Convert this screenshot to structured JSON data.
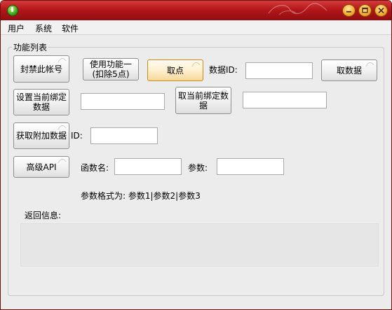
{
  "menu": {
    "items": [
      "用户",
      "系统",
      "软件"
    ]
  },
  "group": {
    "title": "功能列表"
  },
  "buttons": {
    "ban_account": "封禁此帐号",
    "use_feature_one": "使用功能一(扣除5点)",
    "get_point": "取点",
    "get_data": "取数据",
    "set_bind_data": "设置当前绑定数据",
    "cancel_bind_data": "取当前绑定数据",
    "get_extra_data": "获取附加数据",
    "advanced_api": "高级API"
  },
  "labels": {
    "data_id": "数据ID:",
    "id": "ID:",
    "function_name": "函数名:",
    "param": "参数:",
    "param_format": "参数格式为: 参数1|参数2|参数3",
    "return_info": "返回信息:"
  },
  "inputs": {
    "data_id": "",
    "bind_data": "",
    "cancel_bind_data": "",
    "extra_id": "",
    "function_name": "",
    "param": ""
  },
  "titlebar": {
    "icons": [
      "app-icon",
      "minimize-icon",
      "maximize-icon",
      "close-icon"
    ],
    "colors": {
      "titlebar": "#b3171a",
      "buttons": "#f2b13a"
    }
  }
}
